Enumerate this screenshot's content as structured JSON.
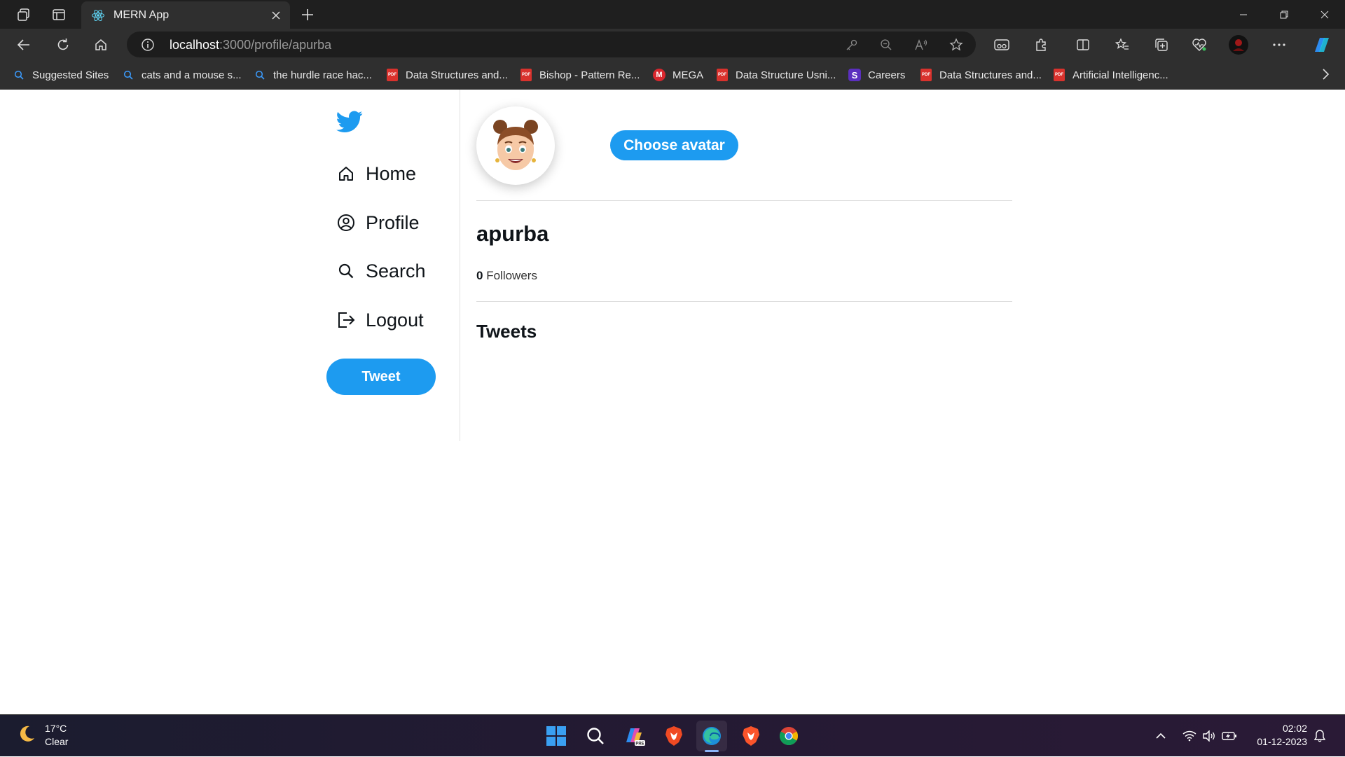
{
  "browser": {
    "tab_title": "MERN App",
    "url_host": "localhost",
    "url_rest": ":3000/profile/apurba"
  },
  "bookmarks": [
    {
      "label": "Suggested Sites",
      "icon": "search-icon"
    },
    {
      "label": "cats and a mouse s...",
      "icon": "search-icon"
    },
    {
      "label": "the hurdle race hac...",
      "icon": "search-icon"
    },
    {
      "label": "Data Structures and...",
      "icon": "pdf-icon"
    },
    {
      "label": "Bishop - Pattern Re...",
      "icon": "pdf-icon"
    },
    {
      "label": "MEGA",
      "icon": "mega-icon"
    },
    {
      "label": "Data Structure Usni...",
      "icon": "pdf-icon"
    },
    {
      "label": "Careers",
      "icon": "s-icon"
    },
    {
      "label": "Data Structures and...",
      "icon": "pdf-icon"
    },
    {
      "label": "Artificial Intelligenc...",
      "icon": "pdf-icon"
    }
  ],
  "sidebar": {
    "items": [
      {
        "label": "Home",
        "icon": "home-icon"
      },
      {
        "label": "Profile",
        "icon": "user-circle-icon"
      },
      {
        "label": "Search",
        "icon": "search-icon"
      },
      {
        "label": "Logout",
        "icon": "logout-icon"
      }
    ],
    "tweet_button": "Tweet"
  },
  "profile": {
    "choose_avatar_label": "Choose avatar",
    "username": "apurba",
    "followers_count": "0",
    "followers_label": "Followers",
    "tweets_heading": "Tweets"
  },
  "taskbar": {
    "temperature": "17°C",
    "condition": "Clear",
    "time": "02:02",
    "date": "01-12-2023"
  },
  "colors": {
    "accent": "#1d9bf0",
    "browser_dark": "#2f2f2f"
  }
}
